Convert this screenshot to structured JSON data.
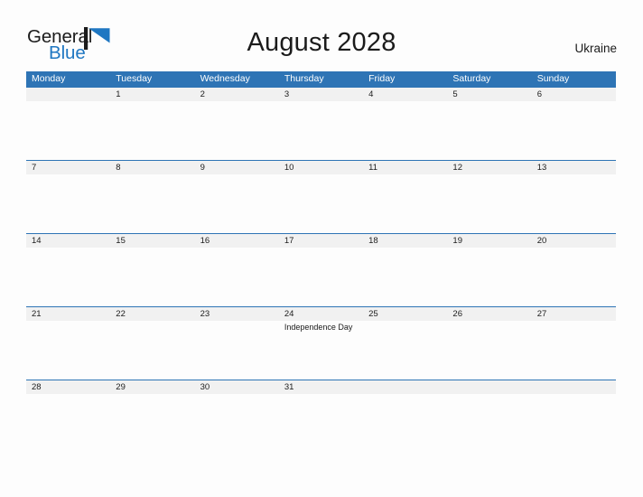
{
  "brand": {
    "name_part1": "General",
    "name_part2": "Blue",
    "flag_icon": "blue-flag-logo-icon",
    "color_dark": "#1b1b1b",
    "color_blue": "#1f77c2"
  },
  "header": {
    "title": "August 2028",
    "country": "Ukraine"
  },
  "theme": {
    "header_blue": "#2e74b5",
    "band_gray": "#f1f1f1",
    "page_bg": "#fdfdfd",
    "text": "#1b1b1b"
  },
  "calendar": {
    "month": "August",
    "year": "2028",
    "weekday_headers": [
      "Monday",
      "Tuesday",
      "Wednesday",
      "Thursday",
      "Friday",
      "Saturday",
      "Sunday"
    ],
    "weeks": [
      {
        "days": [
          {
            "num": "",
            "events": []
          },
          {
            "num": "1",
            "events": []
          },
          {
            "num": "2",
            "events": []
          },
          {
            "num": "3",
            "events": []
          },
          {
            "num": "4",
            "events": []
          },
          {
            "num": "5",
            "events": []
          },
          {
            "num": "6",
            "events": []
          }
        ]
      },
      {
        "days": [
          {
            "num": "7",
            "events": []
          },
          {
            "num": "8",
            "events": []
          },
          {
            "num": "9",
            "events": []
          },
          {
            "num": "10",
            "events": []
          },
          {
            "num": "11",
            "events": []
          },
          {
            "num": "12",
            "events": []
          },
          {
            "num": "13",
            "events": []
          }
        ]
      },
      {
        "days": [
          {
            "num": "14",
            "events": []
          },
          {
            "num": "15",
            "events": []
          },
          {
            "num": "16",
            "events": []
          },
          {
            "num": "17",
            "events": []
          },
          {
            "num": "18",
            "events": []
          },
          {
            "num": "19",
            "events": []
          },
          {
            "num": "20",
            "events": []
          }
        ]
      },
      {
        "days": [
          {
            "num": "21",
            "events": []
          },
          {
            "num": "22",
            "events": []
          },
          {
            "num": "23",
            "events": []
          },
          {
            "num": "24",
            "events": [
              "Independence Day"
            ]
          },
          {
            "num": "25",
            "events": []
          },
          {
            "num": "26",
            "events": []
          },
          {
            "num": "27",
            "events": []
          }
        ]
      },
      {
        "days": [
          {
            "num": "28",
            "events": []
          },
          {
            "num": "29",
            "events": []
          },
          {
            "num": "30",
            "events": []
          },
          {
            "num": "31",
            "events": []
          },
          {
            "num": "",
            "events": []
          },
          {
            "num": "",
            "events": []
          },
          {
            "num": "",
            "events": []
          }
        ]
      }
    ]
  }
}
